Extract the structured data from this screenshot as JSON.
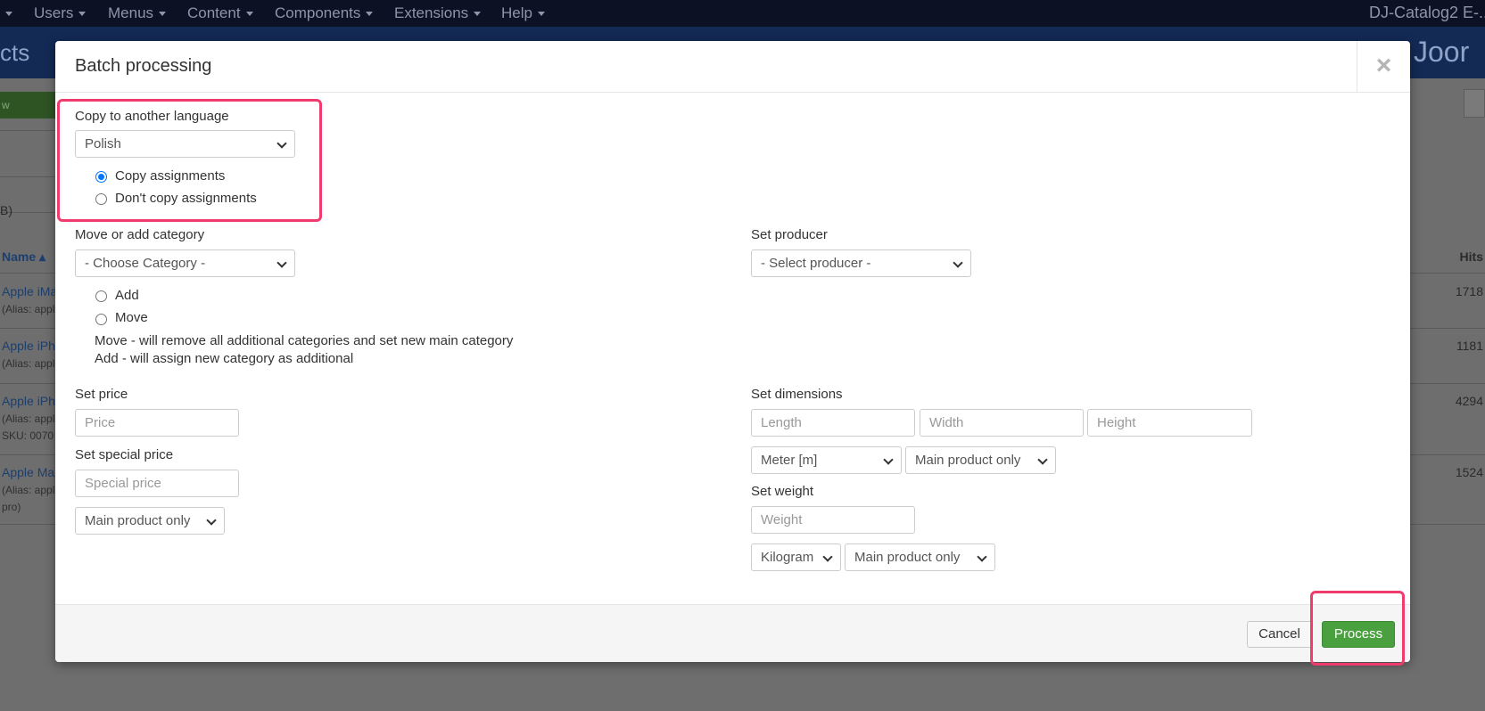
{
  "top_menu": {
    "items": [
      {
        "label": "Users"
      },
      {
        "label": "Menus"
      },
      {
        "label": "Content"
      },
      {
        "label": "Components"
      },
      {
        "label": "Extensions"
      },
      {
        "label": "Help"
      }
    ],
    "site_name": "DJ-Catalog2 E-..."
  },
  "page_header": {
    "title_fragment": "cts",
    "logo_fragment": "Joor"
  },
  "background_list": {
    "green_button_fragment": "w",
    "filter_fragment": "B)",
    "name_header": "Name ▴",
    "hits_header": "Hits",
    "rows": [
      {
        "name": "Apple iMa",
        "alias": "(Alias: appl",
        "extra": "",
        "hits": "1718"
      },
      {
        "name": "Apple iPh",
        "alias": "(Alias: appl",
        "extra": "",
        "hits": "1181"
      },
      {
        "name": "Apple iPh",
        "alias": "(Alias: appl",
        "extra": "SKU: 0070",
        "hits": "4294"
      },
      {
        "name": "Apple Ma",
        "alias": "(Alias: appl",
        "extra": "pro)",
        "hits": "1524"
      }
    ]
  },
  "modal": {
    "title": "Batch processing",
    "close_symbol": "×",
    "language": {
      "label": "Copy to another language",
      "selected": "Polish",
      "options": [
        {
          "label": "Copy assignments",
          "checked": true
        },
        {
          "label": "Don't copy assignments",
          "checked": false
        }
      ]
    },
    "category": {
      "label": "Move or add category",
      "selected": "- Choose Category -",
      "options": [
        {
          "label": "Add",
          "checked": false
        },
        {
          "label": "Move",
          "checked": false
        }
      ],
      "help_move": "Move - will remove all additional categories and set new main category",
      "help_add": "Add - will assign new category as additional"
    },
    "producer": {
      "label": "Set producer",
      "selected": "- Select producer -"
    },
    "price": {
      "label": "Set price",
      "placeholder": "Price"
    },
    "special_price": {
      "label": "Set special price",
      "placeholder": "Special price",
      "scope_selected": "Main product only"
    },
    "dimensions": {
      "label": "Set dimensions",
      "length_placeholder": "Length",
      "width_placeholder": "Width",
      "height_placeholder": "Height",
      "unit_selected": "Meter [m]",
      "scope_selected": "Main product only"
    },
    "weight": {
      "label": "Set weight",
      "placeholder": "Weight",
      "unit_selected": "Kilogram",
      "scope_selected": "Main product only"
    },
    "footer": {
      "cancel_label": "Cancel",
      "process_label": "Process"
    }
  },
  "colors": {
    "highlight": "#ef3b6d",
    "process_button": "#4aa03f",
    "radio_checked": "#0075ff"
  }
}
